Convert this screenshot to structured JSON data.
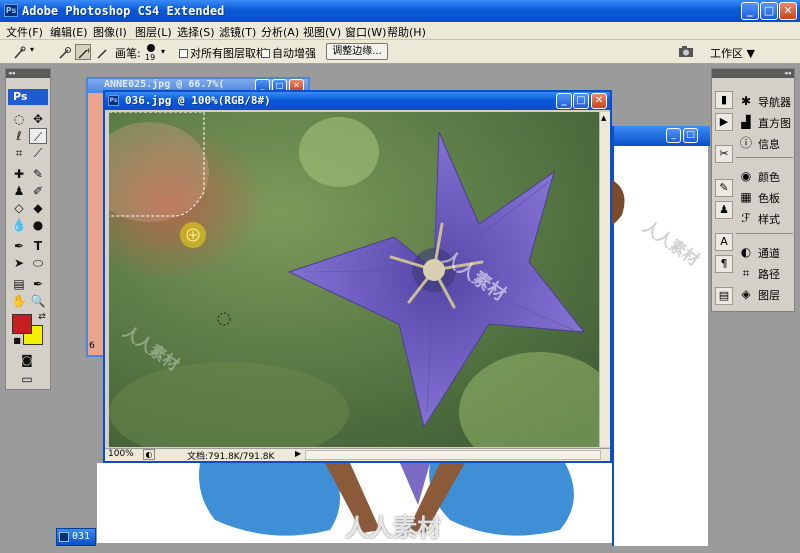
{
  "app": {
    "title": "Adobe Photoshop CS4 Extended",
    "icon_label": "Ps"
  },
  "menu": {
    "items": [
      "文件(F)",
      "编辑(E)",
      "图像(I)",
      "图层(L)",
      "选择(S)",
      "滤镜(T)",
      "分析(A)",
      "视图(V)",
      "窗口(W)",
      "帮助(H)"
    ]
  },
  "options_bar": {
    "brush_label": "画笔:",
    "brush_size": "19",
    "sample_all_layers": "对所有图层取样",
    "auto_enhance": "自动增强",
    "refine_edge_button": "调整边缘...",
    "workspace_label": "工作区 ▼"
  },
  "toolbox": {
    "badge": "Ps",
    "grip": "◂◂",
    "foreground_color": "#c41e1e",
    "background_color": "#f5f000"
  },
  "panels": {
    "grip": "◂◂",
    "items": [
      {
        "icon": "navigator-icon",
        "label": "导航器"
      },
      {
        "icon": "histogram-icon",
        "label": "直方图"
      },
      {
        "icon": "info-icon",
        "label": "信息"
      },
      {
        "icon": "color-icon",
        "label": "颜色"
      },
      {
        "icon": "swatches-icon",
        "label": "色板"
      },
      {
        "icon": "styles-icon",
        "label": "样式"
      },
      {
        "icon": "channels-icon",
        "label": "通道"
      },
      {
        "icon": "paths-icon",
        "label": "路径"
      },
      {
        "icon": "layers-icon",
        "label": "图层"
      }
    ]
  },
  "documents": {
    "back_title": "ANNE025.jpg @ 66.7%(",
    "front_title": "036.jpg @ 100%(RGB/8#)",
    "zoom": "100%",
    "doc_size": "文档:791.8K/791.8K",
    "minimized_label": "031",
    "side_number": "6"
  },
  "watermark": {
    "text": "人人素材"
  },
  "colors": {
    "title_blue": "#0a5ad8",
    "chrome": "#ece9d8",
    "flower": "#6f5fc0"
  }
}
